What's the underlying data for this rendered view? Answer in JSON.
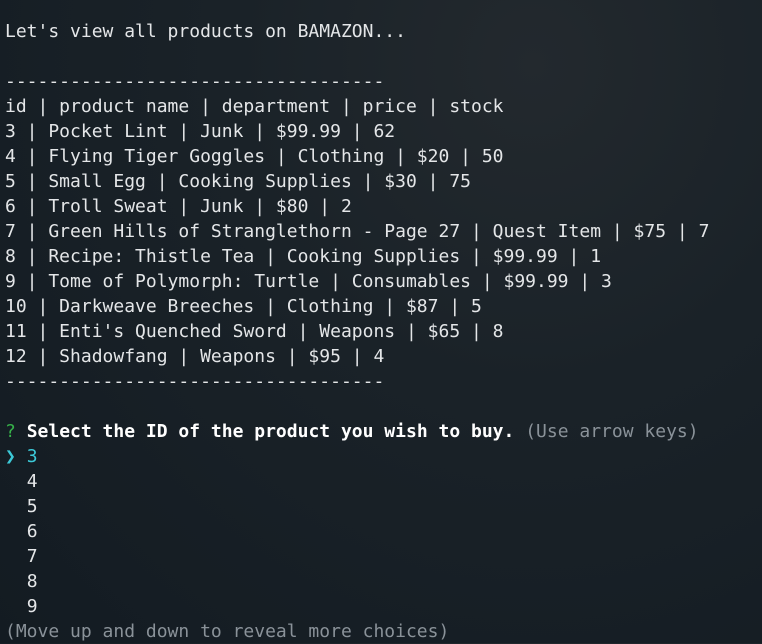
{
  "intro": "Let's view all products on BAMAZON...",
  "divider": "-----------------------------------",
  "table": {
    "header": "id | product name | department | price | stock",
    "rows": [
      "3 | Pocket Lint | Junk | $99.99 | 62",
      "4 | Flying Tiger Goggles | Clothing | $20 | 50",
      "5 | Small Egg | Cooking Supplies | $30 | 75",
      "6 | Troll Sweat | Junk | $80 | 2",
      "7 | Green Hills of Stranglethorn - Page 27 | Quest Item | $75 | 7",
      "8 | Recipe: Thistle Tea | Cooking Supplies | $99.99 | 1",
      "9 | Tome of Polymorph: Turtle | Consumables | $99.99 | 3",
      "10 | Darkweave Breeches | Clothing | $87 | 5",
      "11 | Enti's Quenched Sword | Weapons | $65 | 8",
      "12 | Shadowfang | Weapons | $95 | 4"
    ]
  },
  "prompt": {
    "mark": "?",
    "question": "Select the ID of the product you wish to buy.",
    "hint": "(Use arrow keys)",
    "pointer": "❯",
    "options": [
      "3",
      "4",
      "5",
      "6",
      "7",
      "8",
      "9"
    ],
    "selected_index": 0,
    "footer": "(Move up and down to reveal more choices)"
  },
  "colors": {
    "background": "#1a2228",
    "text": "#e4e6e8",
    "question_mark": "#36b24a",
    "selected": "#3cc9d8",
    "hint": "#8a9299"
  }
}
